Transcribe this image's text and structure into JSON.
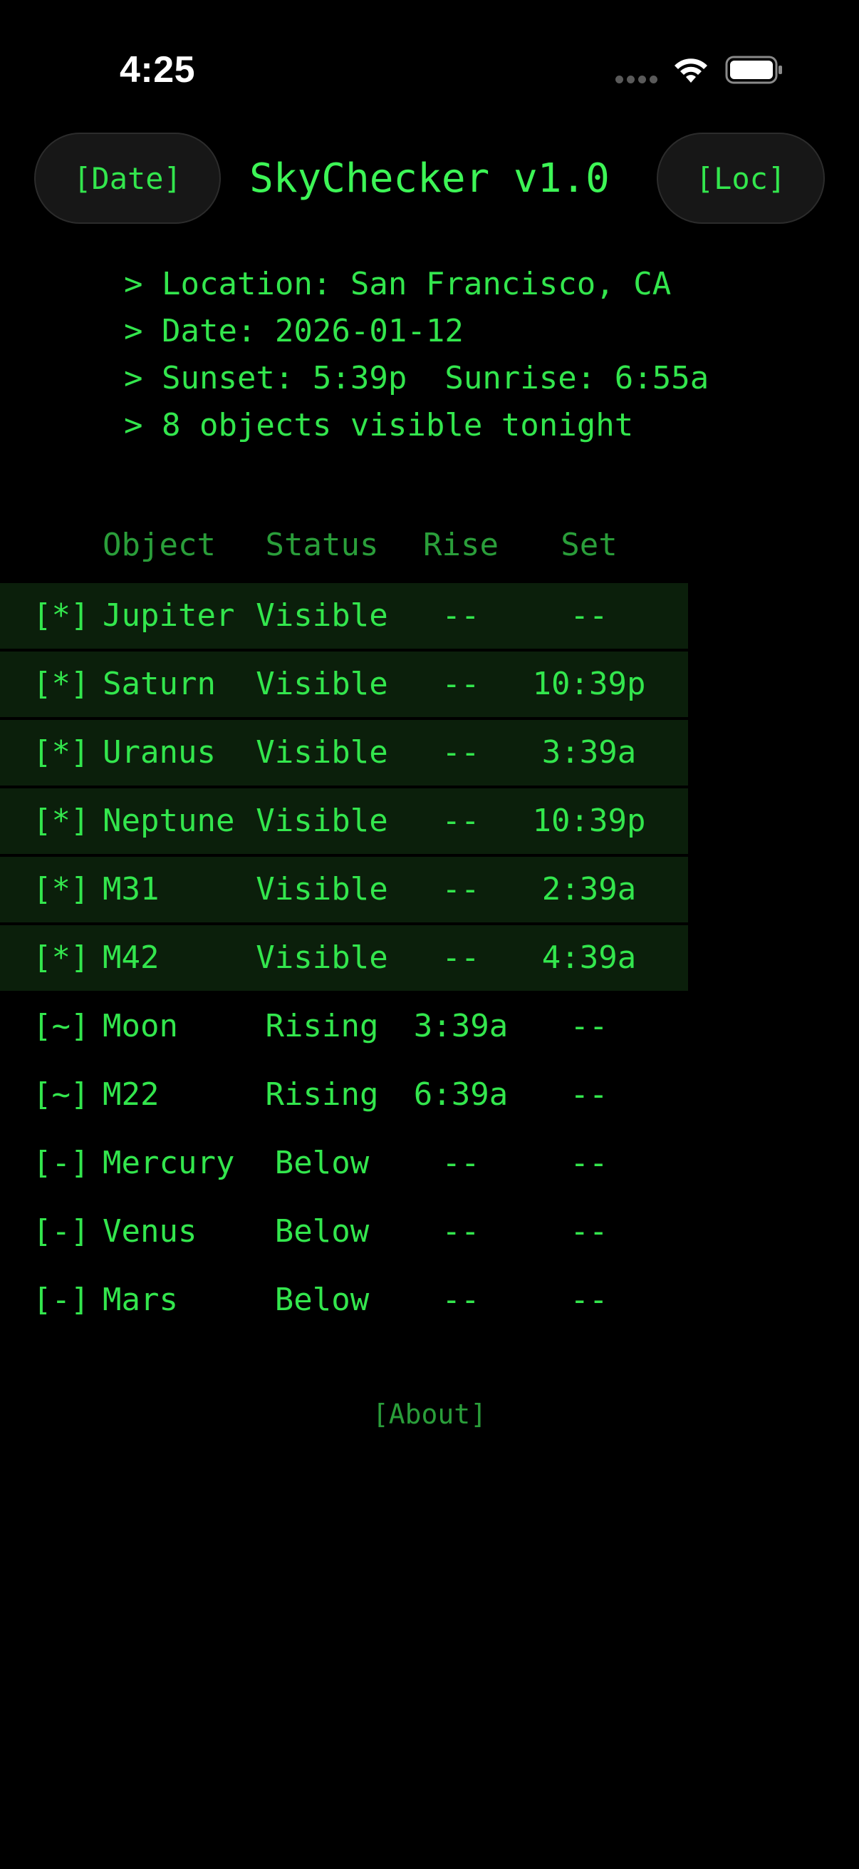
{
  "status_bar": {
    "time": "4:25"
  },
  "header": {
    "date_button": "[Date]",
    "title": "SkyChecker v1.0",
    "loc_button": "[Loc]"
  },
  "info": [
    "> Location: San Francisco, CA",
    "> Date: 2026-01-12",
    "> Sunset: 5:39p  Sunrise: 6:55a",
    "> 8 objects visible tonight"
  ],
  "table": {
    "columns": {
      "object": "Object",
      "status": "Status",
      "rise": "Rise",
      "set": "Set"
    },
    "rows": [
      {
        "mark": "[*]",
        "name": "Jupiter",
        "status": "Visible",
        "rise": "--",
        "set": "--",
        "highlight": true
      },
      {
        "mark": "[*]",
        "name": "Saturn",
        "status": "Visible",
        "rise": "--",
        "set": "10:39p",
        "highlight": true
      },
      {
        "mark": "[*]",
        "name": "Uranus",
        "status": "Visible",
        "rise": "--",
        "set": "3:39a",
        "highlight": true
      },
      {
        "mark": "[*]",
        "name": "Neptune",
        "status": "Visible",
        "rise": "--",
        "set": "10:39p",
        "highlight": true
      },
      {
        "mark": "[*]",
        "name": "M31",
        "status": "Visible",
        "rise": "--",
        "set": "2:39a",
        "highlight": true
      },
      {
        "mark": "[*]",
        "name": "M42",
        "status": "Visible",
        "rise": "--",
        "set": "4:39a",
        "highlight": true
      },
      {
        "mark": "[~]",
        "name": "Moon",
        "status": "Rising",
        "rise": "3:39a",
        "set": "--",
        "highlight": false
      },
      {
        "mark": "[~]",
        "name": "M22",
        "status": "Rising",
        "rise": "6:39a",
        "set": "--",
        "highlight": false
      },
      {
        "mark": "[-]",
        "name": "Mercury",
        "status": "Below",
        "rise": "--",
        "set": "--",
        "highlight": false
      },
      {
        "mark": "[-]",
        "name": "Venus",
        "status": "Below",
        "rise": "--",
        "set": "--",
        "highlight": false
      },
      {
        "mark": "[-]",
        "name": "Mars",
        "status": "Below",
        "rise": "--",
        "set": "--",
        "highlight": false
      }
    ]
  },
  "footer": {
    "about_link": "[About]"
  },
  "colors": {
    "background": "#000000",
    "terminal_green": "#33e64d",
    "dim_green": "#2a9e3a",
    "row_highlight": "#0b1f0b"
  }
}
